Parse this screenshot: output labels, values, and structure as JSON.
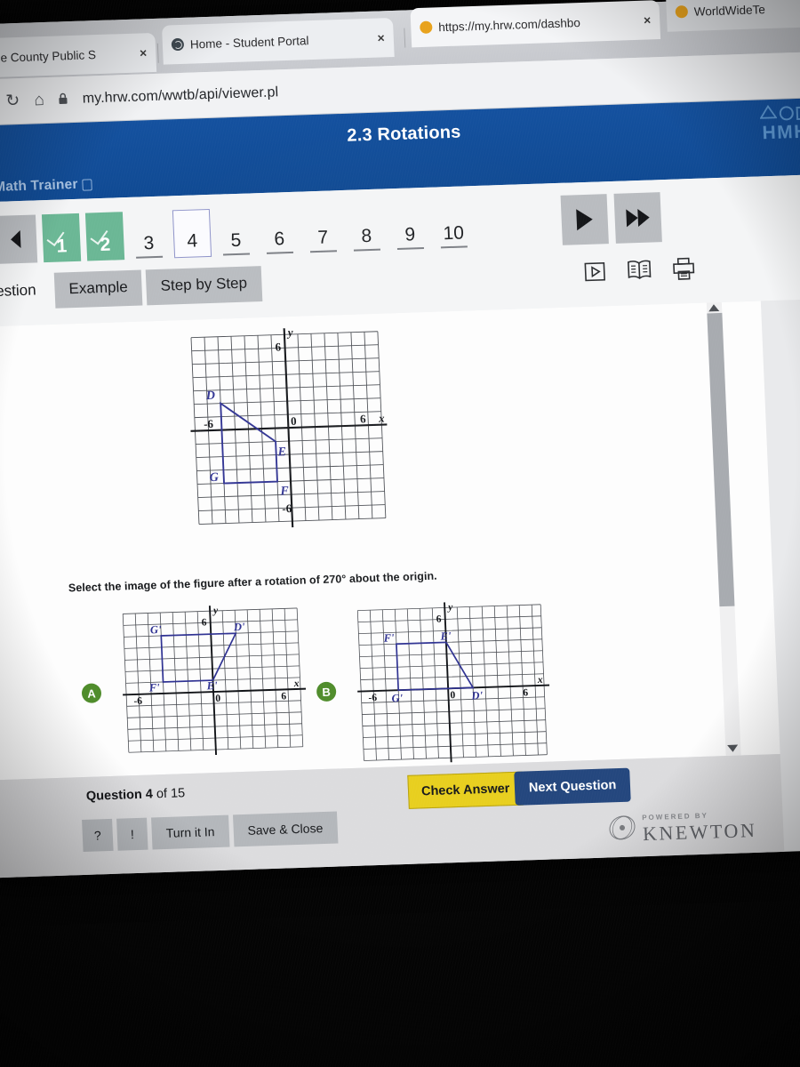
{
  "browser": {
    "tabs": [
      {
        "title": "Miami-Dade County Public S",
        "favicon": "none-icon",
        "close": "×"
      },
      {
        "title": "Home - Student Portal",
        "favicon": "globe-icon",
        "close": "×"
      },
      {
        "title": "https://my.hrw.com/dashbo",
        "favicon": "orange-dot-icon",
        "close": "×"
      },
      {
        "title": "WorldWideTe",
        "favicon": "orange-dot-icon",
        "close": "×"
      }
    ],
    "nav": {
      "forward": "→",
      "reload": "↻",
      "home": "⌂",
      "lock": "🔒"
    },
    "url": "my.hrw.com/wwtb/api/viewer.pl"
  },
  "app": {
    "brand": "Personal Math Trainer",
    "title": "2.3 Rotations",
    "logo_text": "HMH"
  },
  "question_nav": {
    "first_label": "⏮",
    "prev_label": "◀",
    "numbers": [
      {
        "label": "1",
        "state": "done"
      },
      {
        "label": "2",
        "state": "done"
      },
      {
        "label": "3",
        "state": "plain"
      },
      {
        "label": "4",
        "state": "current"
      },
      {
        "label": "5",
        "state": "plain"
      },
      {
        "label": "6",
        "state": "plain"
      },
      {
        "label": "7",
        "state": "plain"
      },
      {
        "label": "8",
        "state": "plain"
      },
      {
        "label": "9",
        "state": "plain"
      },
      {
        "label": "10",
        "state": "plain"
      }
    ],
    "play_label": "▶",
    "fastforward_label": "▶▶"
  },
  "mode_tabs": [
    {
      "label": "Question",
      "active": true
    },
    {
      "label": "Example",
      "active": false
    },
    {
      "label": "Step by Step",
      "active": false
    }
  ],
  "tool_icons": [
    {
      "name": "video-icon"
    },
    {
      "name": "book-icon"
    },
    {
      "name": "print-icon"
    }
  ],
  "main": {
    "prompt": "Select the image of the figure after a rotation of 270° about the origin."
  },
  "chart_data": [
    {
      "id": "figure-original",
      "type": "scatter",
      "title": "",
      "xlabel": "x",
      "ylabel": "y",
      "xlim": [
        -7,
        7
      ],
      "ylim": [
        -7,
        7
      ],
      "grid": true,
      "tick_labels": {
        "x": [
          "-6",
          "0",
          "6"
        ],
        "y": [
          "6",
          "-6"
        ]
      },
      "polygon": {
        "name": "DEFG",
        "points": [
          {
            "label": "D",
            "x": -5,
            "y": 2
          },
          {
            "label": "E",
            "x": -1,
            "y": -1
          },
          {
            "label": "F",
            "x": -1,
            "y": -4
          },
          {
            "label": "G",
            "x": -5,
            "y": -4
          }
        ],
        "color": "#2e3192"
      }
    },
    {
      "id": "choice-a",
      "type": "scatter",
      "title": "A",
      "xlabel": "x",
      "ylabel": "y",
      "xlim": [
        -7,
        7
      ],
      "ylim": [
        -7,
        7
      ],
      "grid": true,
      "tick_labels": {
        "x": [
          "-6",
          "0",
          "6"
        ],
        "y": [
          "6"
        ]
      },
      "polygon": {
        "name": "D'E'F'G'",
        "points": [
          {
            "label": "D'",
            "x": 2,
            "y": 5
          },
          {
            "label": "E'",
            "x": -1,
            "y": 1
          },
          {
            "label": "F'",
            "x": -4,
            "y": 1
          },
          {
            "label": "G'",
            "x": -4,
            "y": 5
          }
        ],
        "color": "#2e3192"
      }
    },
    {
      "id": "choice-b",
      "type": "scatter",
      "title": "B",
      "xlabel": "x",
      "ylabel": "y",
      "xlim": [
        -7,
        7
      ],
      "ylim": [
        -7,
        7
      ],
      "grid": true,
      "tick_labels": {
        "x": [
          "-6",
          "0",
          "6"
        ],
        "y": [
          "6"
        ]
      },
      "polygon": {
        "name": "D'E'F'G'",
        "points": [
          {
            "label": "D'",
            "x": 2,
            "y": 0
          },
          {
            "label": "E'",
            "x": -1,
            "y": 4
          },
          {
            "label": "F'",
            "x": -4,
            "y": 4
          },
          {
            "label": "G'",
            "x": -4,
            "y": 0
          }
        ],
        "color": "#2e3192"
      }
    }
  ],
  "choices": [
    {
      "letter": "A"
    },
    {
      "letter": "B"
    }
  ],
  "footer": {
    "question_count_prefix": "Question",
    "question_current": "4",
    "question_of": "of",
    "question_total": "15",
    "help_label": "?",
    "info_label": "!",
    "turn_in_label": "Turn it In",
    "save_close_label": "Save & Close",
    "check_answer_label": "Check Answer",
    "next_question_label": "Next Question",
    "powered_by": "POWERED BY",
    "vendor": "KNEWTON"
  },
  "colors": {
    "app_header": "#14519f",
    "accent_green": "#6bb795",
    "check_yellow": "#e8cf1f",
    "next_blue": "#24477e",
    "figure_blue": "#2e3192",
    "choice_badge": "#4f8c2b"
  }
}
